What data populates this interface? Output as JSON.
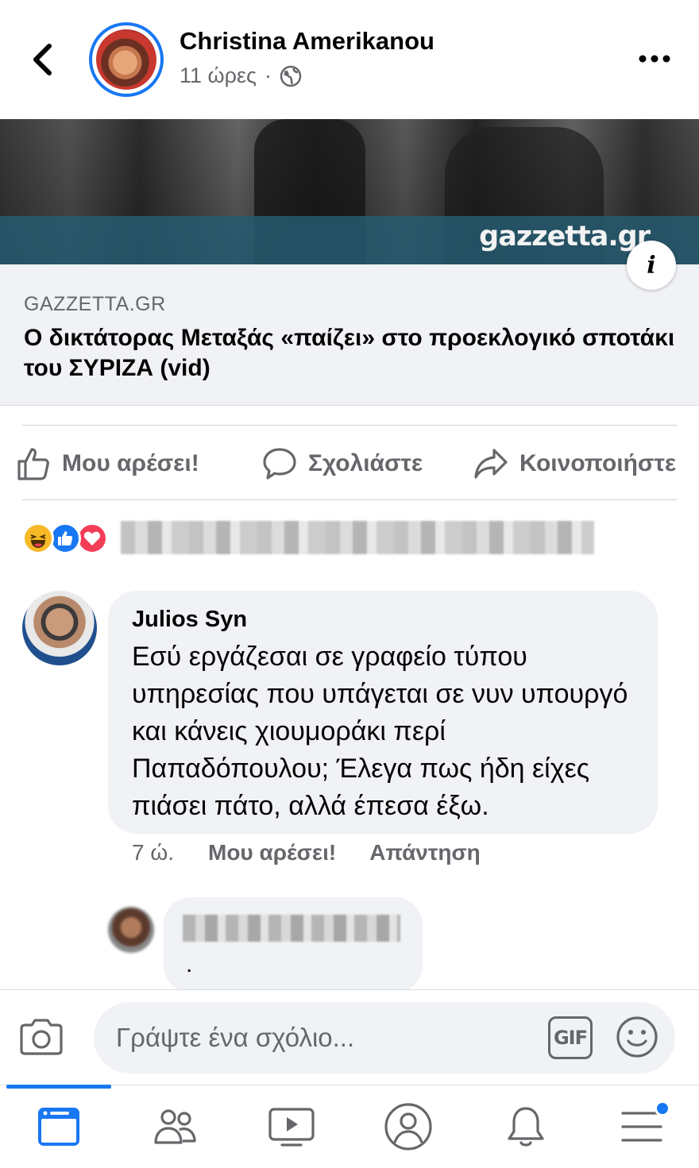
{
  "post": {
    "author": "Christina Amerikanou",
    "time": "11 ώρες",
    "separator": "·",
    "audience_icon": "globe-icon"
  },
  "link_preview": {
    "watermark": "gazzetta.gr",
    "source": "GAZZETTA.GR",
    "title": "Ο δικτάτορας Μεταξάς «παίζει» στο προεκλογικό σποτάκι του ΣΥΡΙΖΑ (vid)",
    "info_icon_glyph": "i"
  },
  "actions": {
    "like": "Μου αρέσει!",
    "comment": "Σχολιάστε",
    "share": "Κοινοποιήστε"
  },
  "reactions": [
    "haha",
    "like",
    "love"
  ],
  "comment": {
    "author": "Julios Syn",
    "text": "Εσύ εργάζεσαι σε γραφείο τύπου υπηρεσίας που υπάγεται σε νυν υπουργό και κάνεις χιουμοράκι περί Παπαδόπουλου; Έλεγα πως ήδη είχες πιάσει πάτο, αλλά έπεσα έξω.",
    "time": "7 ώ.",
    "like_label": "Μου αρέσει!",
    "reply_label": "Απάντηση"
  },
  "reply": {
    "text": "."
  },
  "composer": {
    "placeholder": "Γράψτε ένα σχόλιο...",
    "gif_label": "GIF"
  },
  "tabbar": {
    "items": [
      "news-feed-icon",
      "friends-icon",
      "watch-icon",
      "profile-icon",
      "notifications-icon",
      "menu-icon"
    ],
    "active": "news-feed-icon",
    "menu_has_badge": true
  },
  "colors": {
    "accent": "#1877f2",
    "secondary_text": "#65676b",
    "bubble_bg": "#f0f2f5"
  }
}
